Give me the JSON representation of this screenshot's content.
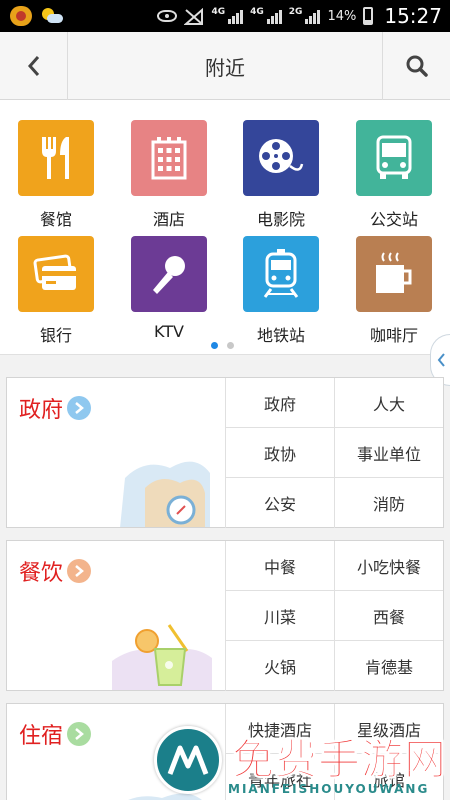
{
  "status_bar": {
    "battery": "14%",
    "time": "15:27",
    "net1": "4G",
    "net2": "4G",
    "net3": "2G"
  },
  "header": {
    "title": "附近"
  },
  "categories": [
    {
      "label": "餐馆",
      "icon": "restaurant-icon",
      "color": "#f0a31c"
    },
    {
      "label": "酒店",
      "icon": "hotel-icon",
      "color": "#e78384"
    },
    {
      "label": "电影院",
      "icon": "cinema-icon",
      "color": "#34469a"
    },
    {
      "label": "公交站",
      "icon": "bus-icon",
      "color": "#42b49a"
    },
    {
      "label": "银行",
      "icon": "bank-card-icon",
      "color": "#f0a31c"
    },
    {
      "label": "KTV",
      "icon": "microphone-icon",
      "color": "#6c3b95"
    },
    {
      "label": "地铁站",
      "icon": "subway-icon",
      "color": "#2ca0dc"
    },
    {
      "label": "咖啡厅",
      "icon": "coffee-icon",
      "color": "#b97f52"
    }
  ],
  "pager": {
    "count": 2,
    "active": 0
  },
  "sections": [
    {
      "title": "政府",
      "arrow_color": "#8fc8ef",
      "items": [
        "政府",
        "人大",
        "政协",
        "事业单位",
        "公安",
        "消防"
      ]
    },
    {
      "title": "餐饮",
      "arrow_color": "#f3b48c",
      "items": [
        "中餐",
        "小吃快餐",
        "川菜",
        "西餐",
        "火锅",
        "肯德基"
      ]
    },
    {
      "title": "住宿",
      "arrow_color": "#a9dca0",
      "items": [
        "快捷酒店",
        "星级酒店",
        "青年旅社",
        "旅馆"
      ]
    }
  ],
  "watermark": {
    "text": "免费手游网",
    "sub": "MIANFEISHOUYOUWANG"
  },
  "colors": {
    "accent": "#1e88e5",
    "section_title": "#e02020"
  }
}
